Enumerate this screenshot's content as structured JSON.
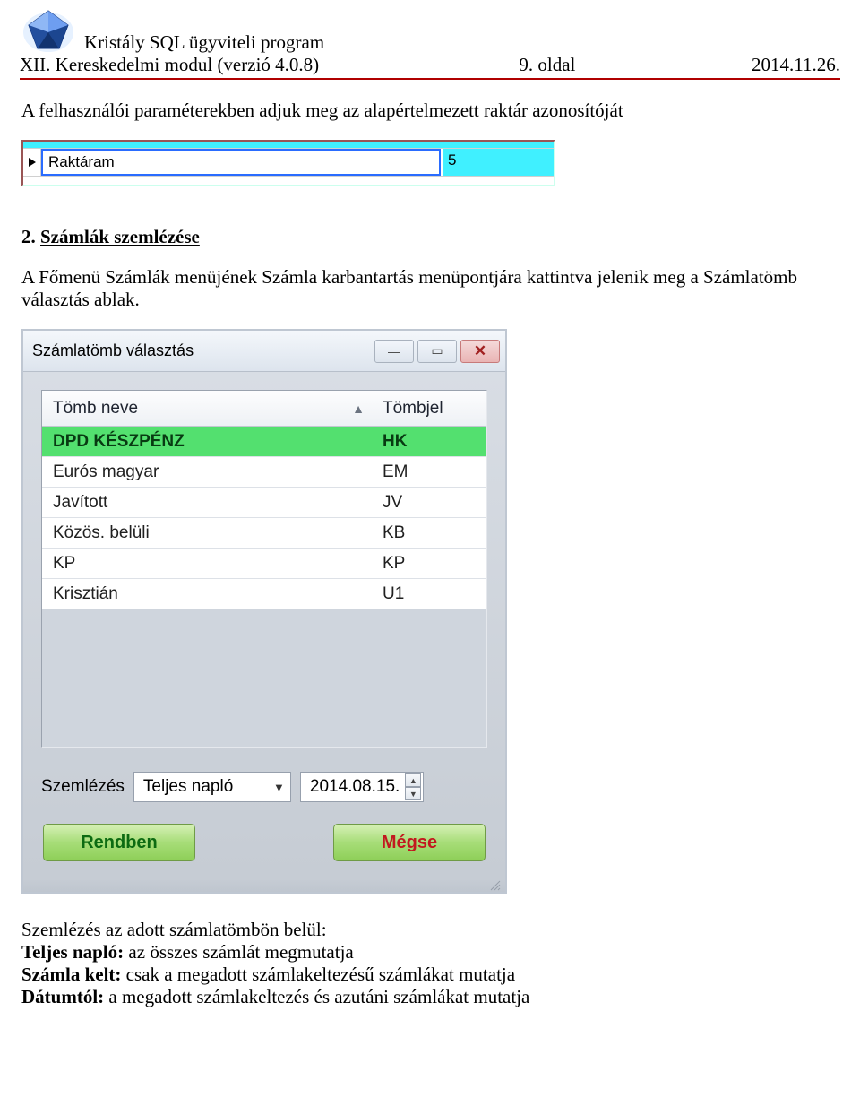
{
  "header": {
    "program_name": "Kristály SQL ügyviteli program",
    "module_line_left": "XII. Kereskedelmi modul (verzió 4.0.8)",
    "page_label": "9. oldal",
    "date": "2014.11.26."
  },
  "para1": "A felhasználói paraméterekben adjuk meg az alapértelmezett raktár azonosítóját",
  "shot1": {
    "name": "Raktáram",
    "value": "5"
  },
  "section2": {
    "num": "2.",
    "title": "Számlák szemlézése"
  },
  "para2": "A Főmenü Számlák menüjének Számla karbantartás menüpontjára kattintva jelenik meg a Számlatömb választás ablak.",
  "dialog": {
    "title": "Számlatömb választás",
    "columns": {
      "name": "Tömb neve",
      "code": "Tömbjel"
    },
    "rows": [
      {
        "name": "DPD KÉSZPÉNZ",
        "code": "HK",
        "selected": true
      },
      {
        "name": "Eurós magyar",
        "code": "EM"
      },
      {
        "name": "Javított",
        "code": "JV"
      },
      {
        "name": "Közös. belüli",
        "code": "KB"
      },
      {
        "name": "KP",
        "code": "KP"
      },
      {
        "name": "Krisztián",
        "code": "U1"
      }
    ],
    "szemlezes_label": "Szemlézés",
    "combo_value": "Teljes napló",
    "date_value": "2014.08.15.",
    "ok": "Rendben",
    "cancel": "Mégse"
  },
  "after": {
    "line1": "Szemlézés az adott számlatömbön belül:",
    "line2_b": "Teljes napló:",
    "line2_r": " az összes számlát megmutatja",
    "line3_b": "Számla kelt:",
    "line3_r": " csak a megadott számlakeltezésű számlákat mutatja",
    "line4_b": "Dátumtól:",
    "line4_r": " a megadott számlakeltezés és azutáni számlákat mutatja"
  }
}
